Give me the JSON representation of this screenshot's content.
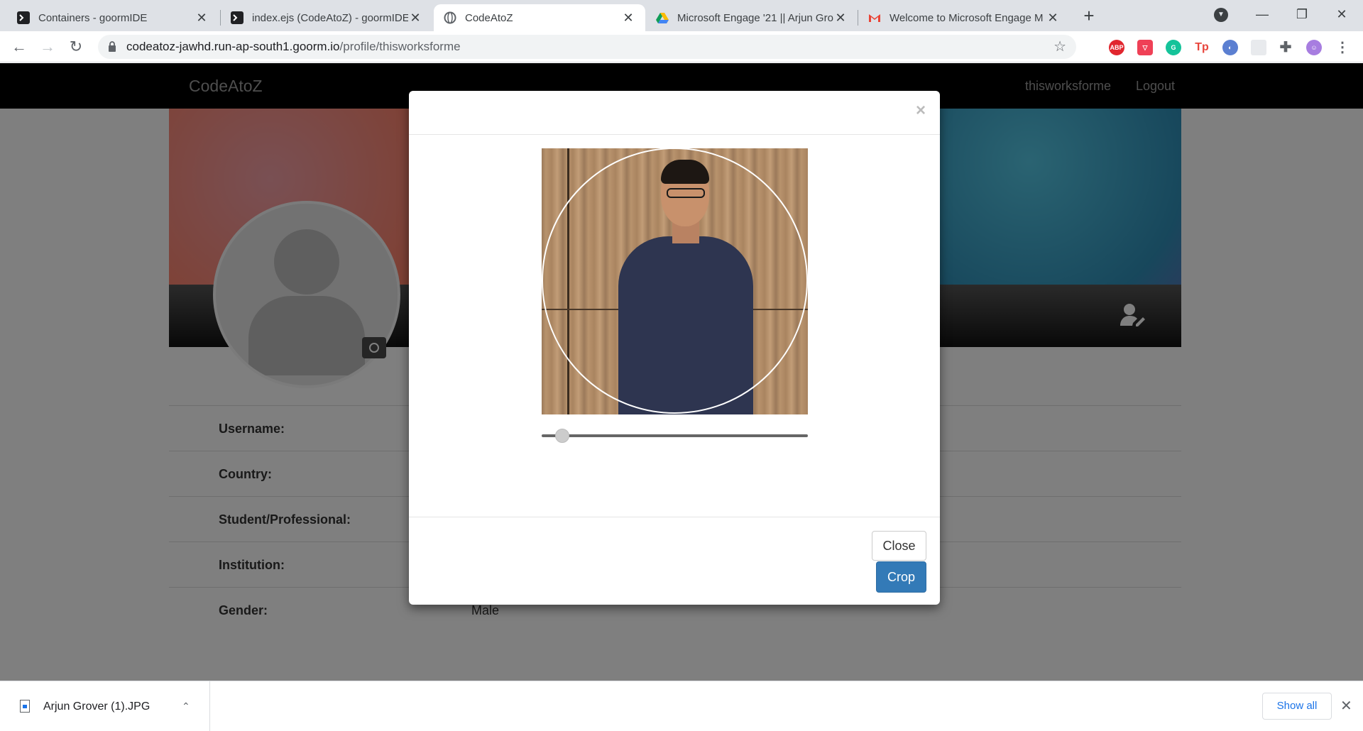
{
  "browser": {
    "tabs": [
      {
        "title": "Containers - goormIDE",
        "icon": "terminal-icon"
      },
      {
        "title": "index.ejs (CodeAtoZ) - goormIDE",
        "icon": "terminal-icon"
      },
      {
        "title": "CodeAtoZ",
        "icon": "globe-icon"
      },
      {
        "title": "Microsoft Engage '21 || Arjun Gro",
        "icon": "google-drive-icon"
      },
      {
        "title": "Welcome to Microsoft Engage M",
        "icon": "gmail-icon"
      }
    ],
    "active_tab": 2,
    "new_tab_symbol": "+",
    "close_symbol": "✕",
    "window_controls": {
      "minimize": "—",
      "restore": "❐",
      "close": "✕"
    },
    "url": {
      "host": "codeatoz-jawhd.run-ap-south1.goorm.io",
      "path": "/profile/thisworksforme"
    },
    "extensions": [
      {
        "name": "ABP",
        "color": "#e1262e"
      },
      {
        "name": "pocket",
        "color": "#ef4056"
      },
      {
        "name": "grammarly",
        "color": "#15c39a"
      },
      {
        "name": "Tp",
        "color": "#e8453c"
      },
      {
        "name": "blue-ext",
        "color": "#5b7fd1"
      }
    ]
  },
  "site": {
    "brand": "CodeAtoZ",
    "nav_user": "thisworksforme",
    "nav_logout": "Logout"
  },
  "profile": {
    "fields": [
      {
        "label": "Username:",
        "value": ""
      },
      {
        "label": "Country:",
        "value": ""
      },
      {
        "label": "Student/Professional:",
        "value": ""
      },
      {
        "label": "Institution:",
        "value": ""
      },
      {
        "label": "Gender:",
        "value": "Male"
      }
    ]
  },
  "modal": {
    "close_x": "×",
    "zoom_slider_value": 0.08,
    "close_button": "Close",
    "crop_button": "Crop"
  },
  "downloads": {
    "file_name": "Arjun Grover (1).JPG",
    "show_all": "Show all",
    "close_symbol": "✕",
    "chevron": "⌃"
  }
}
